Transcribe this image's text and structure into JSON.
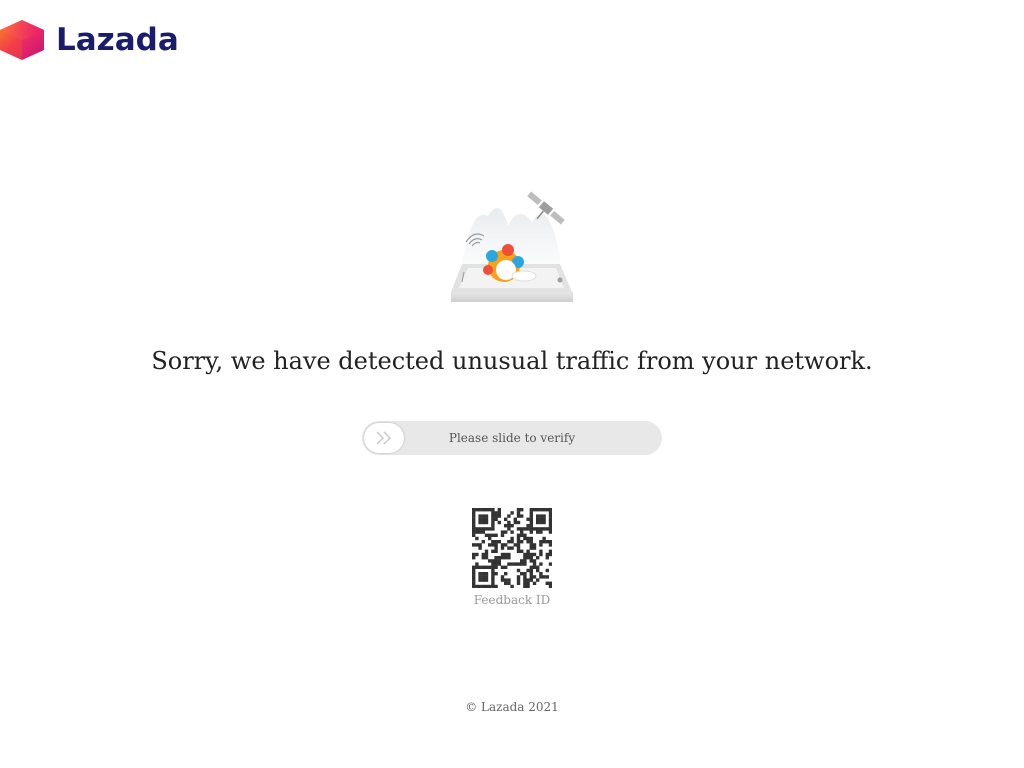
{
  "brand": {
    "name": "Lazada",
    "text_color": "#1a1d6d",
    "logo_gradient": [
      "#f5a623",
      "#ef2c6b",
      "#c3147c"
    ]
  },
  "message": {
    "headline": "Sorry, we have detected unusual traffic from your network.",
    "text_color": "#222222"
  },
  "slider": {
    "label": "Please slide to verify",
    "handle_icon": "double-chevron-right-icon",
    "track_color": "#e8e8e8",
    "text_color": "#555555"
  },
  "qr": {
    "icon": "qr-code-icon",
    "caption": "Feedback ID",
    "caption_color": "#999999"
  },
  "footer": {
    "copyright": "© Lazada 2021",
    "text_color": "#666666"
  }
}
